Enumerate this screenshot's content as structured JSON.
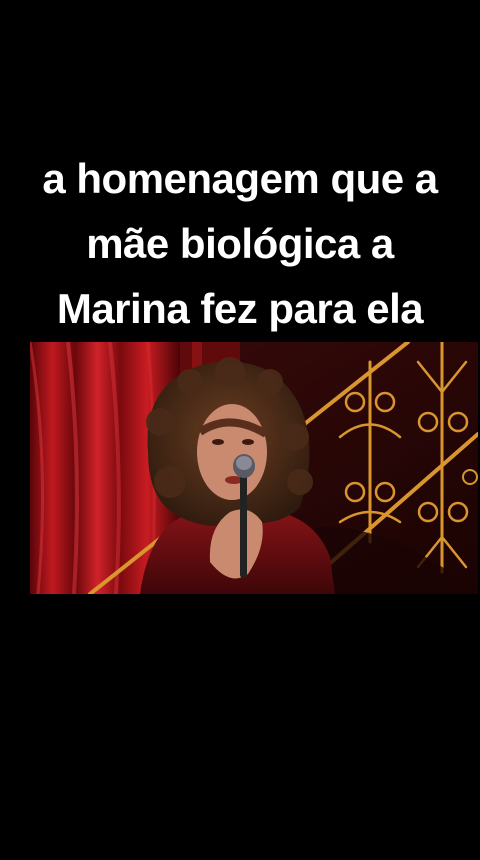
{
  "caption": {
    "line1": "a homenagem que a",
    "line2": "mãe biológica a",
    "line3": "Marina fez para ela"
  },
  "video": {
    "scene": "singer-with-microphone",
    "colors": {
      "curtain": "#b3151c",
      "background": "#1e0505",
      "railing": "#d9952e",
      "hair": "#4a2a18",
      "dress": "#6e0f12",
      "skin": "#c98a70"
    }
  }
}
